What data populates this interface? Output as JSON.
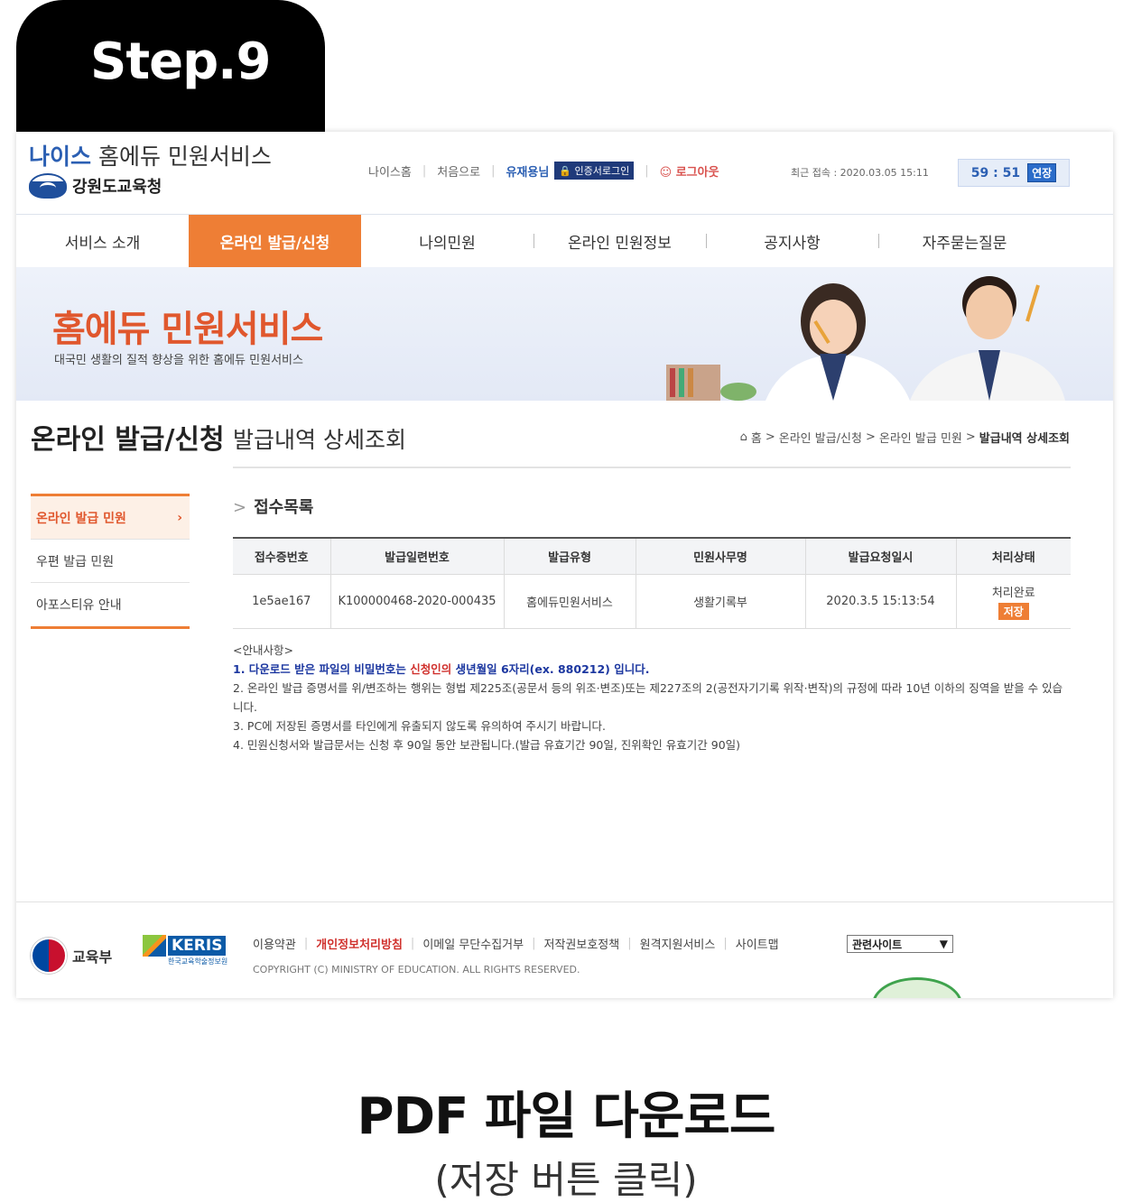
{
  "step_label": "Step.9",
  "header": {
    "logo_brand": "나이스",
    "logo_service": "홈에듀 민원서비스",
    "office": "강원도교육청",
    "util_links": [
      "나이스홈",
      "처음으로"
    ],
    "user_name": "유재용님",
    "cert_label": "인증서로그인",
    "logout": "로그아웃",
    "last_access": "최근 접속 : 2020.03.05 15:11",
    "timer": "59 : 51",
    "extend": "연장"
  },
  "nav": [
    "서비스 소개",
    "온라인 발급/신청",
    "나의민원",
    "온라인 민원정보",
    "공지사항",
    "자주묻는질문"
  ],
  "banner": {
    "title": "홈에듀 민원서비스",
    "subtitle": "대국민 생활의 질적 향상을 위한 홈에듀 민원서비스"
  },
  "lnb": {
    "title": "온라인 발급/신청",
    "items": [
      "온라인 발급 민원",
      "우편 발급 민원",
      "아포스티유 안내"
    ]
  },
  "page": {
    "title": "발급내역 상세조회",
    "breadcrumb": [
      "홈",
      "온라인 발급/신청",
      "온라인 발급 민원",
      "발급내역 상세조회"
    ],
    "section_title": "접수목록"
  },
  "table": {
    "headers": [
      "접수증번호",
      "발급일련번호",
      "발급유형",
      "민원사무명",
      "발급요청일시",
      "처리상태"
    ],
    "row": {
      "receipt_no": "1e5ae167",
      "serial_no": "K100000468-2020-000435",
      "type": "홈에듀민원서비스",
      "service_name": "생활기록부",
      "requested_at": "2020.3.5 15:13:54",
      "status": "처리완료",
      "save_label": "저장"
    }
  },
  "notice": {
    "heading": "<안내사항>",
    "line1_a": "1. 다운로드 받은 파일의 비밀번호는 ",
    "line1_b": "신청인의",
    "line1_c": " 생년월일 6자리(ex. 880212) 입니다.",
    "line2": "2. 온라인 발급 증명서를 위/변조하는 행위는 형법 제225조(공문서 등의 위조·변조)또는 제227조의 2(공전자기기록 위작·변작)의 규정에 따라 10년 이하의 징역을 받을 수 있습니다.",
    "line3": "3. PC에 저장된 증명서를 타인에게 유출되지 않도록 유의하여 주시기 바랍니다.",
    "line4": "4. 민원신청서와 발급문서는 신청 후 90일 동안 보관됩니다.(발급 유효기간 90일, 진위확인 유효기간 90일)"
  },
  "footer": {
    "moe": "교육부",
    "keris": "KERIS",
    "keris_sub": "한국교육학술정보원",
    "links": [
      "이용약관",
      "개인정보처리방침",
      "이메일 무단수집거부",
      "저작권보호정책",
      "원격지원서비스",
      "사이트맵"
    ],
    "related_sites": "관련사이트",
    "copyright": "COPYRIGHT (C) MINISTRY OF EDUCATION. ALL RIGHTS RESERVED."
  },
  "caption": {
    "title": "PDF 파일 다운로드",
    "subtitle": "(저장 버튼 클릭)"
  },
  "colors": {
    "accent_orange": "#ee7e35",
    "brand_blue": "#2b5fb3",
    "notice_blue": "#1c37a0"
  }
}
